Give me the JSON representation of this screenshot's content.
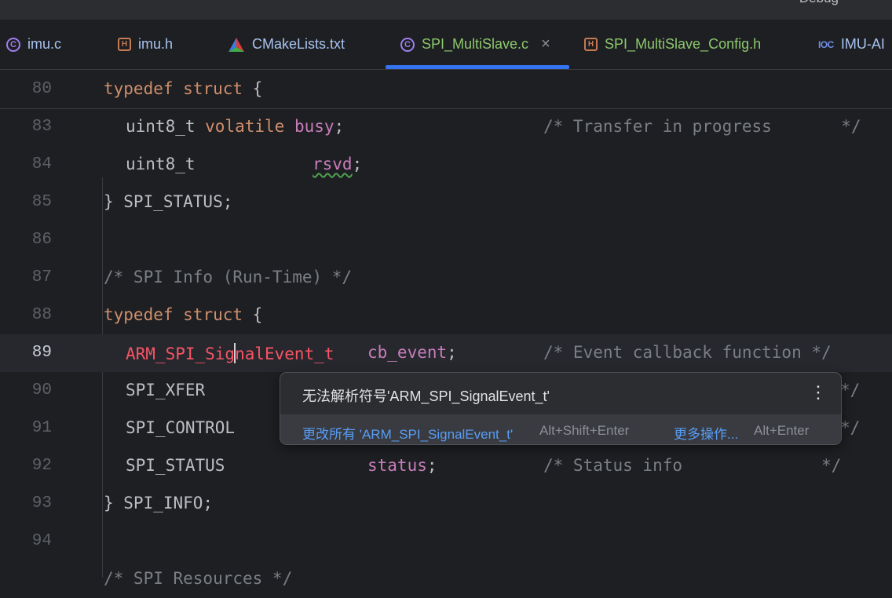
{
  "run_config": "Debug",
  "tabs": [
    {
      "label": "imu.c",
      "icon": "c-file-icon"
    },
    {
      "label": "imu.h",
      "icon": "h-file-icon"
    },
    {
      "label": "CMakeLists.txt",
      "icon": "cmake-icon"
    },
    {
      "label": "SPI_MultiSlave.c",
      "icon": "c-file-icon",
      "active": true,
      "close": "×"
    },
    {
      "label": "SPI_MultiSlave_Config.h",
      "icon": "h-file-icon"
    },
    {
      "label": "IMU-AI",
      "icon": "ioc-file-icon"
    }
  ],
  "icons": {
    "c": "C",
    "h": "H",
    "ioc": "IOC"
  },
  "editor": {
    "lines": {
      "l80": {
        "num": "80",
        "kw1": "typedef",
        "kw2": "struct",
        "rest": " {"
      },
      "l83": {
        "num": "83",
        "type": "uint8_t ",
        "kw": "volatile",
        "field": "busy",
        "semi": ";",
        "comment": "/* Transfer in progress       */"
      },
      "l84": {
        "num": "84",
        "type": "uint8_t",
        "field": "rsvd",
        "semi": ";"
      },
      "l85": {
        "num": "85",
        "text": "} SPI_STATUS;"
      },
      "l86": {
        "num": "86"
      },
      "l87": {
        "num": "87",
        "comment": "/* SPI Info (Run-Time) */"
      },
      "l88": {
        "num": "88",
        "kw1": "typedef",
        "kw2": "struct",
        "rest": " {"
      },
      "l89": {
        "num": "89",
        "err_a": "ARM_SPI_Sig",
        "err_b": "nalEvent_t",
        "field": "cb_event",
        "semi": ";",
        "comment": "/* Event callback function */"
      },
      "l90": {
        "num": "90",
        "type": "SPI_XFER",
        "comment_end": "*/"
      },
      "l91": {
        "num": "91",
        "type": "SPI_CONTROL",
        "comment_end": "*/"
      },
      "l92": {
        "num": "92",
        "type": "SPI_STATUS",
        "field": "status",
        "semi": ";",
        "comment": "/* Status info              */"
      },
      "l93": {
        "num": "93",
        "text": "} SPI_INFO;"
      },
      "l94": {
        "num": "94"
      },
      "l95": {
        "comment": "/* SPI Resources */"
      }
    }
  },
  "popup": {
    "message": "无法解析符号'ARM_SPI_SignalEvent_t'",
    "more_icon": "⋮",
    "action1": "更改所有 'ARM_SPI_SignalEvent_t'",
    "action1_shortcut": "Alt+Shift+Enter",
    "action2": "更多操作...",
    "action2_shortcut": "Alt+Enter"
  },
  "colors": {
    "accent": "#3574f0",
    "keyword": "#cf8e6d",
    "error": "#f75464",
    "field": "#c77dbb",
    "comment": "#7a7e85"
  }
}
